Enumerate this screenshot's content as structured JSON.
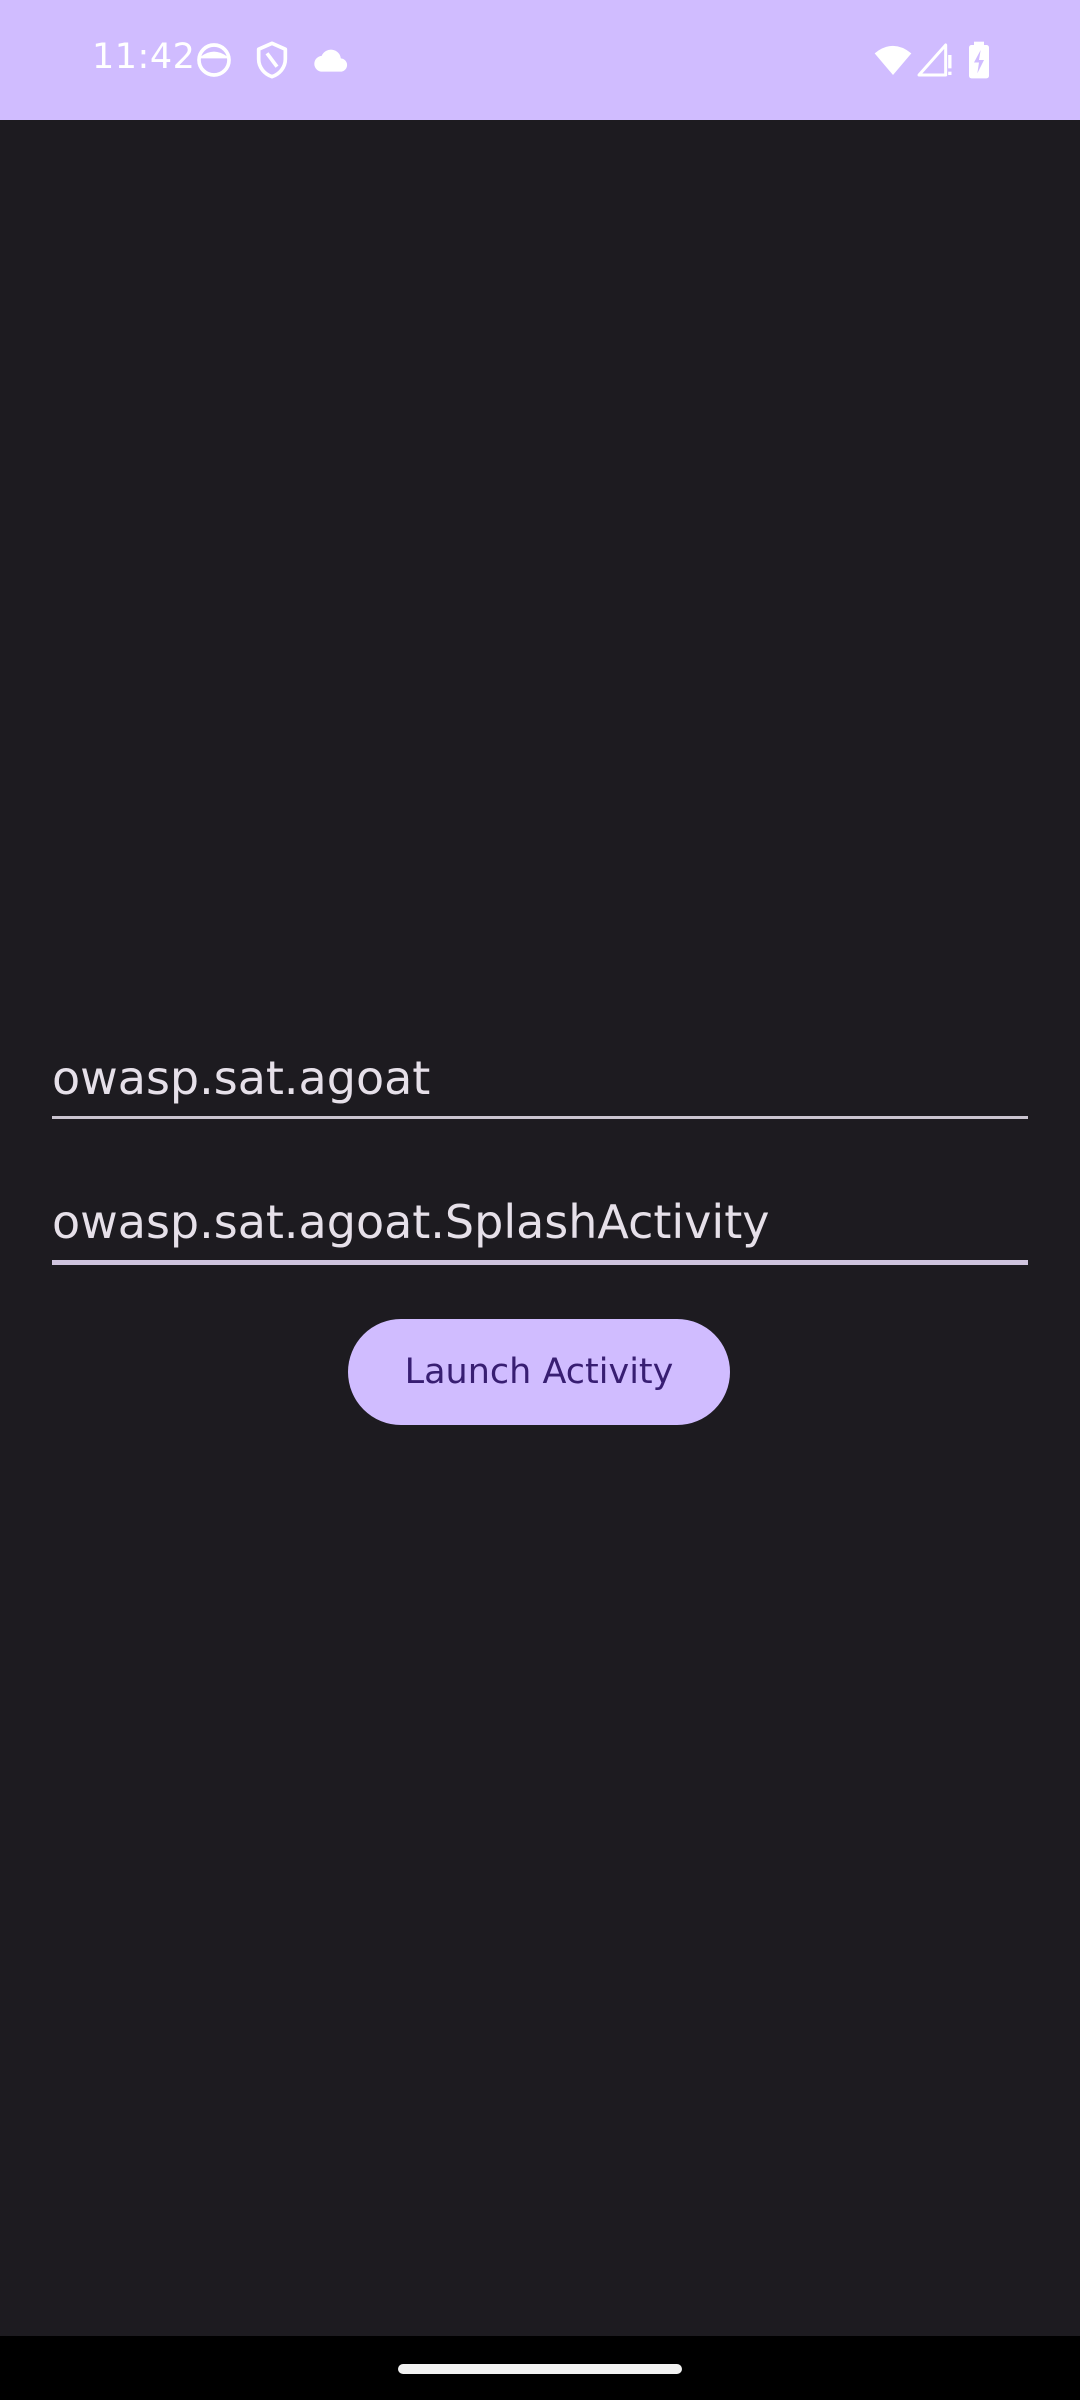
{
  "status_bar": {
    "time": "11:42",
    "bg_color": "#d0bcff",
    "left_icons": [
      "face-icon",
      "shield-icon",
      "cloud-icon"
    ],
    "right_icons": [
      "wifi-icon",
      "cell-signal-icon",
      "battery-charging-icon"
    ]
  },
  "form": {
    "package_value": "owasp.sat.agoat",
    "activity_value": "owasp.sat.agoat.SplashActivity",
    "launch_label": "Launch Activity"
  },
  "colors": {
    "background": "#1d1b20",
    "accent": "#d0bcff",
    "button_text": "#381e72",
    "field_text": "#e6e0e9"
  }
}
